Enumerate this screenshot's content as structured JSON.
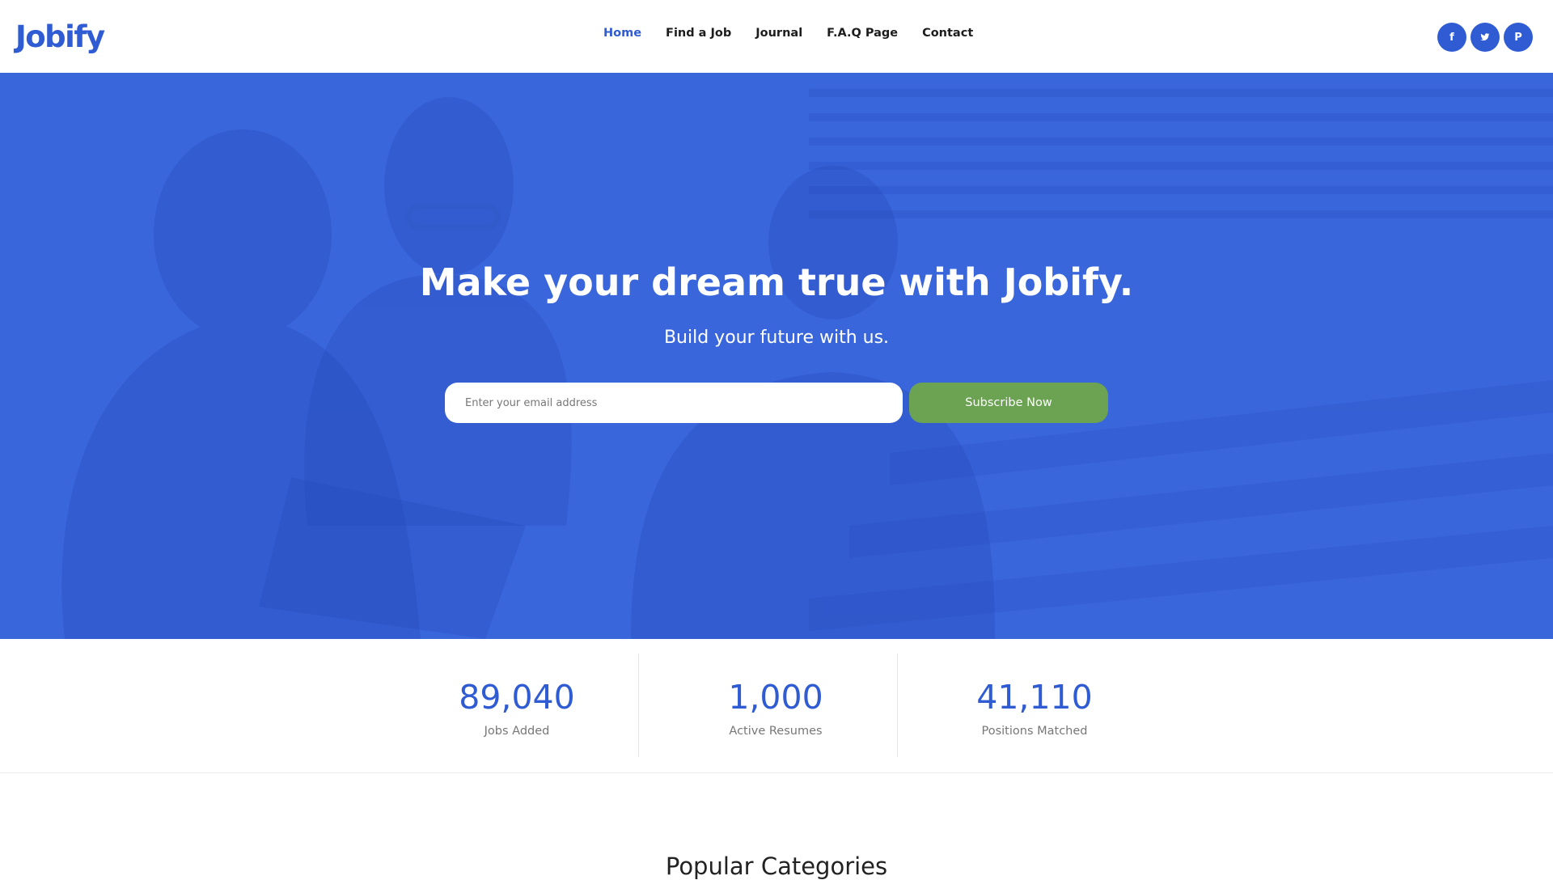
{
  "brand": {
    "name": "Jobify",
    "color": "#2f5bd3"
  },
  "nav": {
    "items": [
      {
        "label": "Home",
        "active": true
      },
      {
        "label": "Find a Job",
        "active": false
      },
      {
        "label": "Journal",
        "active": false
      },
      {
        "label": "F.A.Q Page",
        "active": false
      },
      {
        "label": "Contact",
        "active": false
      }
    ]
  },
  "socials": [
    {
      "icon": "facebook-icon",
      "glyph": "f"
    },
    {
      "icon": "twitter-icon"
    },
    {
      "icon": "pinterest-icon",
      "glyph": "P"
    }
  ],
  "hero": {
    "title": "Make your dream true with Jobify.",
    "subtitle": "Build your future with us.",
    "email_placeholder": "Enter your email address",
    "email_value": "",
    "subscribe_label": "Subscribe Now",
    "overlay_color": "#3a66dc",
    "button_color": "#6ba352"
  },
  "stats": [
    {
      "value": "89,040",
      "label": "Jobs Added"
    },
    {
      "value": "1,000",
      "label": "Active Resumes"
    },
    {
      "value": "41,110",
      "label": "Positions Matched"
    }
  ],
  "categories": {
    "title": "Popular Categories"
  }
}
